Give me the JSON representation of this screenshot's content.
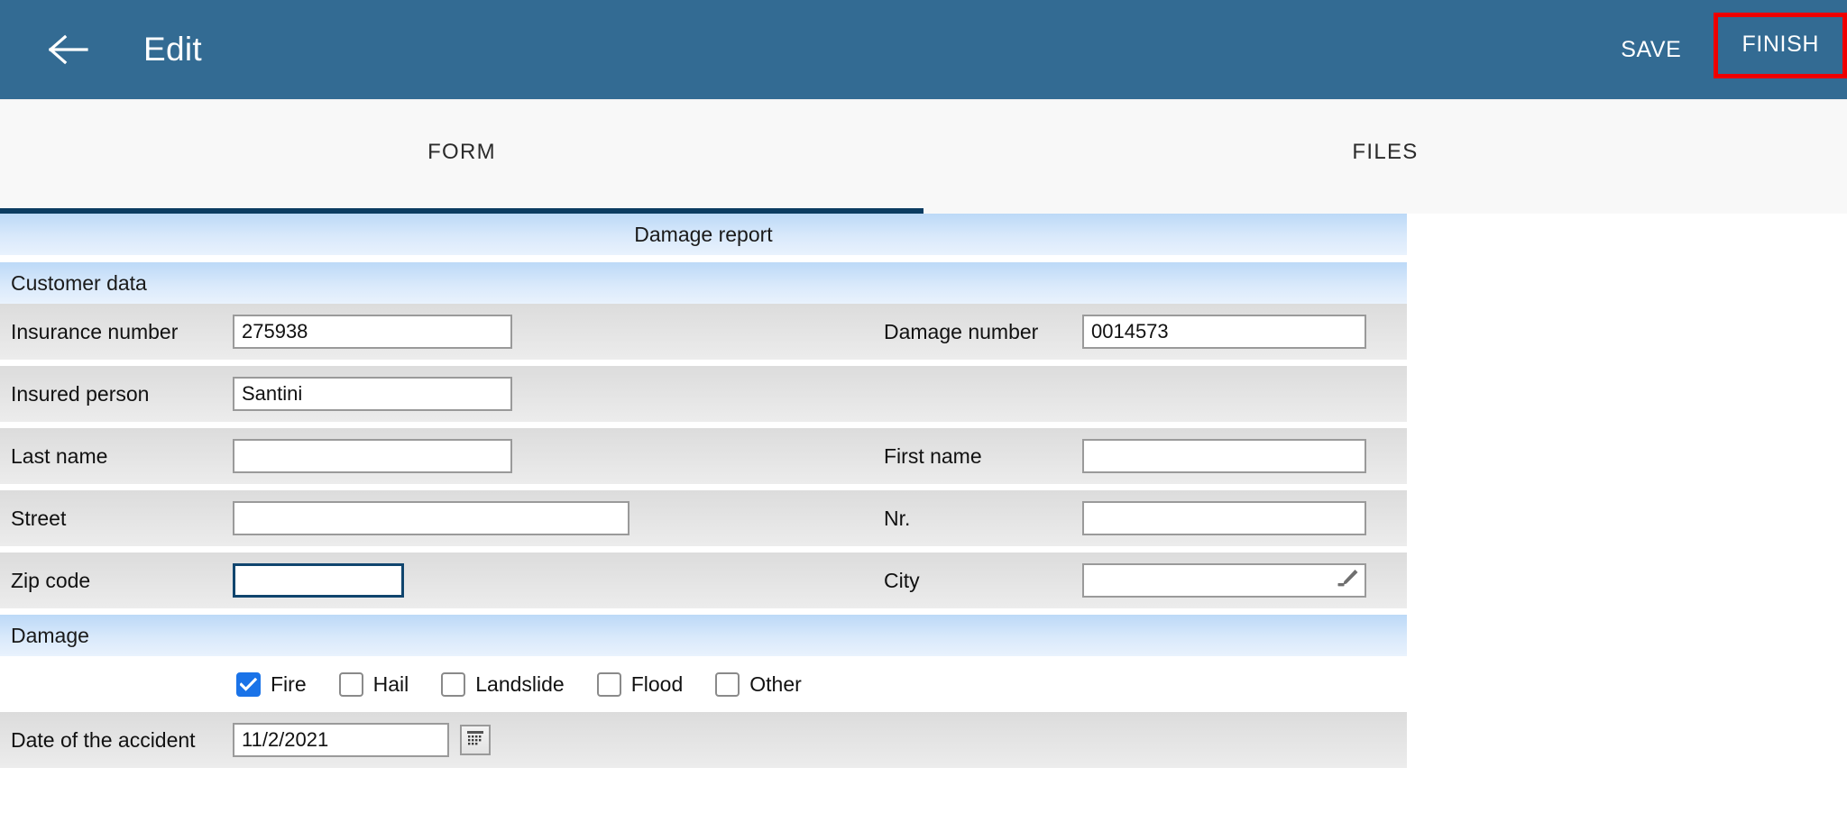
{
  "appbar": {
    "back_icon": "arrow-left-icon",
    "title": "Edit",
    "save_label": "SAVE",
    "finish_label": "FINISH",
    "bar_color": "#336b93",
    "highlight_color": "#ee0000"
  },
  "tabs": [
    {
      "label": "FORM",
      "active": true
    },
    {
      "label": "FILES",
      "active": false
    }
  ],
  "form": {
    "title": "Damage report",
    "sections": [
      {
        "title": "Customer data"
      },
      {
        "title": "Damage"
      }
    ],
    "fields": {
      "insurance_number": {
        "label": "Insurance number",
        "value": "275938"
      },
      "damage_number": {
        "label": "Damage number",
        "value": "0014573"
      },
      "insured_person": {
        "label": "Insured person",
        "value": "Santini"
      },
      "last_name": {
        "label": "Last name",
        "value": ""
      },
      "first_name": {
        "label": "First name",
        "value": ""
      },
      "street": {
        "label": "Street",
        "value": ""
      },
      "nr": {
        "label": "Nr.",
        "value": ""
      },
      "zip_code": {
        "label": "Zip code",
        "value": "",
        "focused": true
      },
      "city": {
        "label": "City",
        "value": "",
        "icon": "pencil-icon"
      },
      "date_of_accident": {
        "label": "Date of the accident",
        "value": "11/2/2021",
        "icon": "calendar-icon"
      }
    },
    "damage_types": [
      {
        "label": "Fire",
        "checked": true
      },
      {
        "label": "Hail",
        "checked": false
      },
      {
        "label": "Landslide",
        "checked": false
      },
      {
        "label": "Flood",
        "checked": false
      },
      {
        "label": "Other",
        "checked": false
      }
    ]
  }
}
